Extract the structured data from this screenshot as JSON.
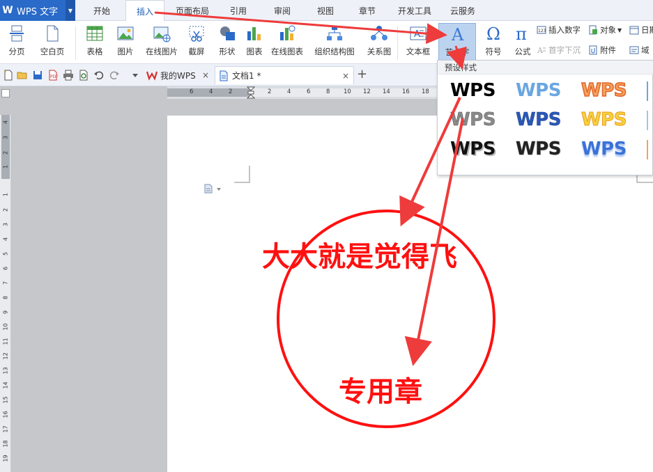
{
  "app": {
    "name": "WPS 文字",
    "logo": "W"
  },
  "menu_tabs": [
    "开始",
    "插入",
    "页面布局",
    "引用",
    "审阅",
    "视图",
    "章节",
    "开发工具",
    "云服务"
  ],
  "active_menu_tab": "插入",
  "ribbon": {
    "buttons": [
      "分页",
      "空白页",
      "表格",
      "图片",
      "在线图片",
      "截屏",
      "形状",
      "图表",
      "在线图表",
      "组织结构图",
      "关系图",
      "文本框",
      "艺术字",
      "符号",
      "公式"
    ],
    "small_buttons": [
      "插入数字",
      "对象",
      "日期",
      "首字下沉",
      "附件",
      "域"
    ]
  },
  "doc_tabs": [
    {
      "label": "我的WPS",
      "close": "×"
    },
    {
      "label": "文档1 *",
      "close": "×"
    }
  ],
  "plus_label": "+",
  "ruler_h": [
    "6",
    "4",
    "2",
    "2",
    "4",
    "6",
    "8",
    "10",
    "12",
    "14",
    "16",
    "18"
  ],
  "ruler_v": [
    "4",
    "3",
    "2",
    "1",
    "1",
    "2",
    "3",
    "4",
    "5",
    "6",
    "7",
    "8",
    "9",
    "10",
    "11",
    "12",
    "13",
    "14",
    "15",
    "16",
    "17",
    "18",
    "19"
  ],
  "dropdown": {
    "header": "预设样式",
    "styles": [
      "WPS",
      "WPS",
      "WPS",
      "WPS",
      "WPS",
      "WPS",
      "WPS",
      "WPS",
      "WPS"
    ]
  },
  "seal": {
    "top_text": "大大就是觉得飞",
    "bottom_text": "专用章",
    "color": "#ff1010"
  },
  "colors": {
    "accent": "#2a6ac8",
    "arrow": "#ee3b3b"
  }
}
